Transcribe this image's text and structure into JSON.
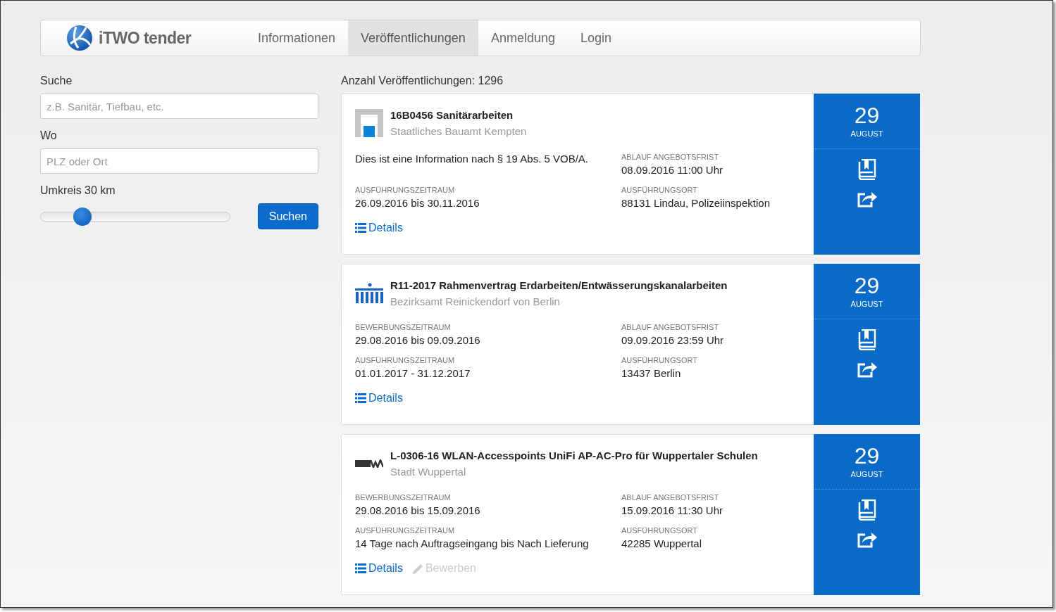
{
  "brand": "iTWO tender",
  "nav": [
    {
      "label": "Informationen",
      "selected": false
    },
    {
      "label": "Veröffentlichungen",
      "selected": true
    },
    {
      "label": "Anmeldung",
      "selected": false
    },
    {
      "label": "Login",
      "selected": false
    }
  ],
  "search": {
    "label": "Suche",
    "placeholder": "z.B. Sanitär, Tiefbau, etc."
  },
  "where": {
    "label": "Wo",
    "placeholder": "PLZ oder Ort"
  },
  "radius": {
    "label": "Umkreis 30 km",
    "level": 0.22
  },
  "search_button": "Suchen",
  "count": "Anzahl Veröffentlichungen: 1296",
  "results": [
    {
      "kind": "bauamt",
      "title": "16B0456 Sanitärarbeiten",
      "org": "Staatliches Bauamt Kempten",
      "day": "29",
      "month": "AUGUST",
      "fields": [
        {
          "kind": "note",
          "value": "Dies ist eine Information nach § 19 Abs. 5 VOB/A."
        },
        {
          "kind": "field",
          "label": "ABLAUF ANGEBOTSFRIST",
          "value": "08.09.2016 11:00 Uhr"
        },
        {
          "kind": "field",
          "label": "AUSFÜHRUNGSZEITRAUM",
          "value": "26.09.2016 bis 30.11.2016"
        },
        {
          "kind": "field",
          "label": "AUSFÜHRUNGSORT",
          "value": "88131 Lindau, Polizeiinspektion"
        }
      ],
      "links": [
        {
          "kind": "details",
          "label": "Details",
          "disabled": false
        }
      ]
    },
    {
      "kind": "berlin",
      "title": "R11-2017 Rahmenvertrag Erdarbeiten/Entwässerungskanalarbeiten",
      "org": "Bezirksamt Reinickendorf von Berlin",
      "day": "29",
      "month": "AUGUST",
      "fields": [
        {
          "kind": "field",
          "label": "BEWERBUNGSZEITRAUM",
          "value": "29.08.2016 bis 09.09.2016"
        },
        {
          "kind": "field",
          "label": "ABLAUF ANGEBOTSFRIST",
          "value": "09.09.2016 23:59 Uhr"
        },
        {
          "kind": "field",
          "label": "AUSFÜHRUNGSZEITRAUM",
          "value": "01.01.2017 - 31.12.2017"
        },
        {
          "kind": "field",
          "label": "AUSFÜHRUNGSORT",
          "value": "13437 Berlin"
        }
      ],
      "links": [
        {
          "kind": "details",
          "label": "Details",
          "disabled": false
        }
      ]
    },
    {
      "kind": "wuppertal",
      "title": "L-0306-16 WLAN-Accesspoints UniFi AP-AC-Pro für Wuppertaler Schulen",
      "org": "Stadt Wuppertal",
      "day": "29",
      "month": "AUGUST",
      "fields": [
        {
          "kind": "field",
          "label": "BEWERBUNGSZEITRAUM",
          "value": "29.08.2016 bis 15.09.2016"
        },
        {
          "kind": "field",
          "label": "ABLAUF ANGEBOTSFRIST",
          "value": "15.09.2016 11:30 Uhr"
        },
        {
          "kind": "field",
          "label": "AUSFÜHRUNGSZEITRAUM",
          "value": "14 Tage nach Auftragseingang bis Nach Lieferung"
        },
        {
          "kind": "field",
          "label": "AUSFÜHRUNGSORT",
          "value": "42285 Wuppertal"
        }
      ],
      "links": [
        {
          "kind": "details",
          "label": "Details",
          "disabled": false
        },
        {
          "kind": "apply",
          "label": "Bewerben",
          "disabled": true
        }
      ]
    }
  ]
}
